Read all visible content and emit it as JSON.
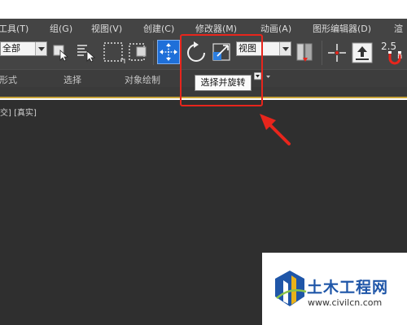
{
  "menu": {
    "items": [
      "工具(T)",
      "组(G)",
      "视图(V)",
      "创建(C)",
      "修改器(M)",
      "动画(A)",
      "图形编辑器(D)",
      "渲"
    ]
  },
  "toolbar": {
    "selection_filter": "全部",
    "reference_coord": "视图",
    "snap_value": "2.5",
    "snap_suffix": "n"
  },
  "ribbon": {
    "items": [
      "形式",
      "选择",
      "对象绘制"
    ]
  },
  "tooltip": {
    "text": "选择并旋转"
  },
  "viewport": {
    "label": "交] [真实]"
  },
  "watermark": {
    "title": "土木工程网",
    "url": "www.civilcn.com"
  },
  "colors": {
    "ui_dark": "#444444",
    "viewport_bg": "#2f2f2f",
    "active_tool_blue": "#1e6fd9",
    "highlight_red": "#e8251c",
    "watermark_blue": "#1f56a8"
  },
  "icons": {
    "select_object": "cursor-arrow-icon",
    "select_by_name": "list-cursor-icon",
    "rect_region": "dashed-rect-icon",
    "window_crossing": "window-crossing-icon",
    "move": "move-arrows-icon",
    "rotate": "rotate-icon",
    "scale": "scale-icon",
    "pivot": "pivot-icon",
    "pivot_center": "crosshair-icon",
    "align": "align-icon",
    "snap": "snap-magnet-icon"
  }
}
